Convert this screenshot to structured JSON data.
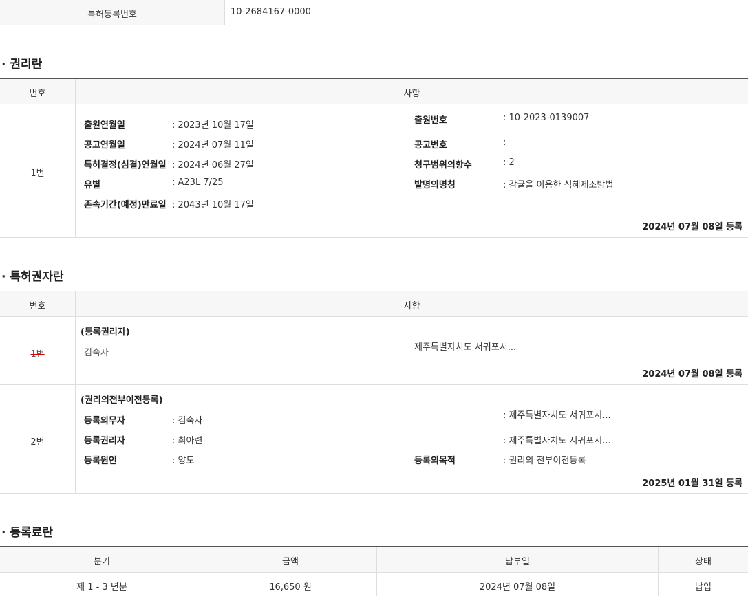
{
  "top_row": {
    "label": "특허등록번호",
    "value": "10-2684167-0000"
  },
  "rights": {
    "title": "· 권리란",
    "headers": {
      "no": "번호",
      "content": "사항"
    },
    "row": {
      "no": "1번",
      "left": [
        {
          "label": "출원연월일",
          "value": ": 2023년 10월 17일"
        },
        {
          "label": "공고연월일",
          "value": ": 2024년 07월 11일"
        },
        {
          "label": "특허결정(심결)연월일",
          "value": ": 2024년 06월 27일"
        },
        {
          "label": "유별",
          "value": ": A23L 7/25"
        },
        {
          "label": "존속기간(예정)만료일",
          "value": ": 2043년 10월 17일"
        }
      ],
      "right": [
        {
          "label": "출원번호",
          "value": ": 10-2023-0139007"
        },
        {
          "label": "공고번호",
          "value": ":"
        },
        {
          "label": "청구범위의항수",
          "value": ": 2"
        },
        {
          "label": "발명의명칭",
          "value": ": 감귤을 이용한 식혜제조방법"
        }
      ],
      "date": "2024년 07월 08일 등록"
    }
  },
  "holders": {
    "title": "· 특허권자란",
    "headers": {
      "no": "번호",
      "content": "사항"
    },
    "row1": {
      "no": "1번",
      "type": "(등록권리자)",
      "name": "김숙자",
      "address": "제주특별자치도 서귀포시...",
      "date": "2024년 07월 08일 등록"
    },
    "row2": {
      "no": "2번",
      "type": "(권리의전부이전등록)",
      "fields": [
        {
          "label": "등록의무자",
          "value": ": 김숙자",
          "extra": ": 제주특별자치도 서귀포시..."
        },
        {
          "label": "등록권리자",
          "value": ": 최아련",
          "extra": ": 제주특별자치도 서귀포시..."
        },
        {
          "label": "등록원인",
          "value": ": 양도"
        }
      ],
      "purpose_label": "등록의목적",
      "purpose_value": ": 권리의 전부이전등록",
      "date": "2025년 01월 31일 등록"
    }
  },
  "fees": {
    "title": "· 등록료란",
    "headers": [
      "분기",
      "금액",
      "납부일",
      "상태"
    ],
    "rows": [
      [
        "제 1 - 3 년분",
        "16,650 원",
        "2024년 07월 08일",
        "납입"
      ]
    ]
  }
}
